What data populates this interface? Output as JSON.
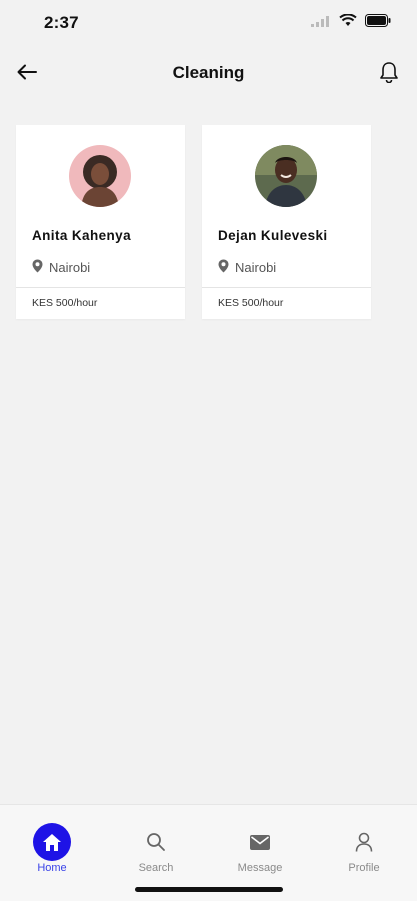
{
  "status_bar": {
    "time": "2:37"
  },
  "header": {
    "title": "Cleaning"
  },
  "cleaners": [
    {
      "name": "Anita Kahenya",
      "location": "Nairobi",
      "rate": "KES 500/hour"
    },
    {
      "name": "Dejan Kuleveski",
      "location": "Nairobi",
      "rate": "KES 500/hour"
    }
  ],
  "bottom_nav": {
    "items": [
      {
        "label": "Home",
        "icon": "home-icon",
        "active": true
      },
      {
        "label": "Search",
        "icon": "search-icon",
        "active": false
      },
      {
        "label": "Message",
        "icon": "mail-icon",
        "active": false
      },
      {
        "label": "Profile",
        "icon": "person-icon",
        "active": false
      }
    ]
  },
  "colors": {
    "accent": "#1e13e6",
    "active_label": "#3a43e8",
    "background": "#f2f2f2"
  }
}
